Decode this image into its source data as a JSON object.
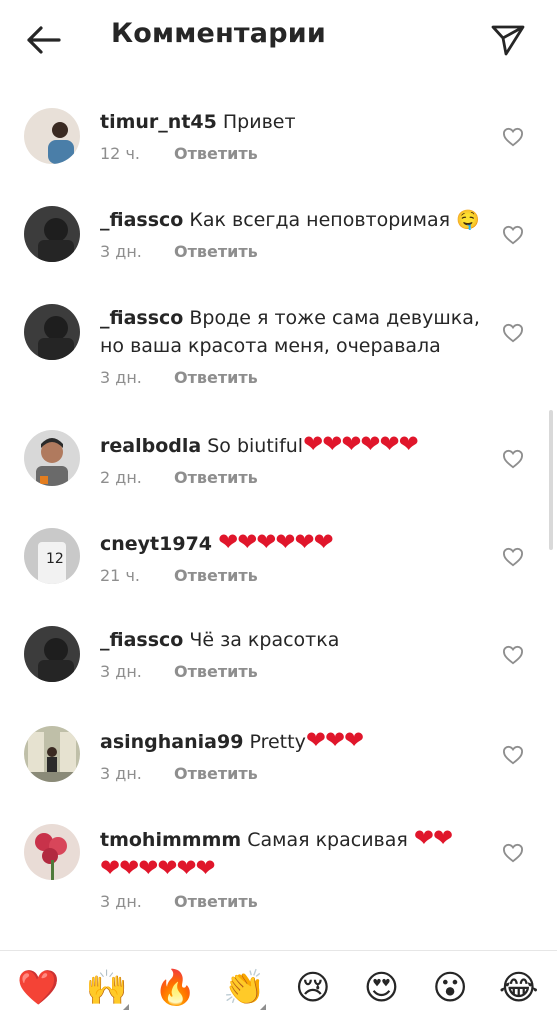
{
  "header": {
    "title": "Комментарии"
  },
  "comments": [
    {
      "username": "timur_nt45",
      "text": "Привет",
      "time": "12 ч.",
      "reply": "Ответить"
    },
    {
      "username": "_fiassco",
      "text": "Как всегда неповторимая",
      "emoji": "🤤",
      "time": "3 дн.",
      "reply": "Ответить"
    },
    {
      "username": "_fiassco",
      "text": "Вроде я тоже сама девушка, но ваша красота меня, очеравала",
      "time": "3 дн.",
      "reply": "Ответить"
    },
    {
      "username": "realbodla",
      "text": "So biutiful",
      "hearts": "❤❤❤❤❤❤",
      "time": "2 дн.",
      "reply": "Ответить"
    },
    {
      "username": "cneyt1974",
      "text": "",
      "hearts": "❤❤❤❤❤❤",
      "time": "21 ч.",
      "reply": "Ответить"
    },
    {
      "username": "_fiassco",
      "text": "Чё за красотка",
      "time": "3 дн.",
      "reply": "Ответить"
    },
    {
      "username": "asinghania99",
      "text": "Pretty",
      "hearts": "❤❤❤",
      "time": "3 дн.",
      "reply": "Ответить"
    },
    {
      "username": "tmohimmmm",
      "text": "Самая красивая",
      "hearts": "❤❤",
      "hearts2": "❤❤❤❤❤❤",
      "time": "3 дн.",
      "reply": "Ответить"
    }
  ],
  "reactions": [
    "❤️",
    "🙌",
    "🔥",
    "👏",
    "😢",
    "😍",
    "😮",
    "😂"
  ]
}
